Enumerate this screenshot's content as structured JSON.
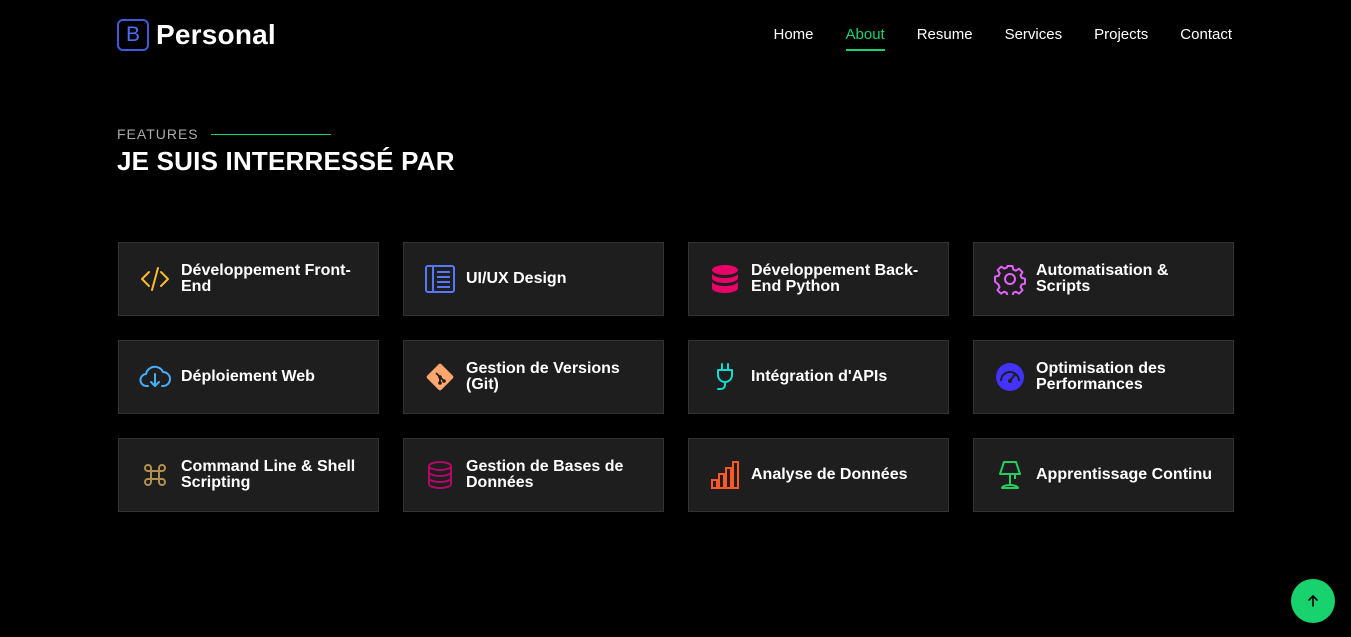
{
  "brand": {
    "letter": "B",
    "name": "Personal"
  },
  "nav": [
    {
      "label": "Home",
      "active": false
    },
    {
      "label": "About",
      "active": true
    },
    {
      "label": "Resume",
      "active": false
    },
    {
      "label": "Services",
      "active": false
    },
    {
      "label": "Projects",
      "active": false
    },
    {
      "label": "Contact",
      "active": false
    }
  ],
  "section": {
    "kicker": "FEATURES",
    "title": "JE SUIS INTERRESSÉ PAR"
  },
  "features": [
    {
      "label": "Développement Front-End",
      "icon": "code-icon",
      "color": "#ffbb2c"
    },
    {
      "label": "UI/UX Design",
      "icon": "layout-icon",
      "color": "#5578ff"
    },
    {
      "label": "Développement Back-End Python",
      "icon": "database-icon",
      "color": "#e80368"
    },
    {
      "label": "Automatisation & Scripts",
      "icon": "gear-icon",
      "color": "#e361ff"
    },
    {
      "label": "Déploiement Web",
      "icon": "cloud-download-icon",
      "color": "#47aeff"
    },
    {
      "label": "Gestion de Versions (Git)",
      "icon": "git-icon",
      "color": "#ffa76e"
    },
    {
      "label": "Intégration d'APIs",
      "icon": "plug-icon",
      "color": "#11dbcf"
    },
    {
      "label": "Optimisation des Performances",
      "icon": "speedometer-icon",
      "color": "#4233ff"
    },
    {
      "label": "Command Line & Shell Scripting",
      "icon": "command-icon",
      "color": "#b2904f"
    },
    {
      "label": "Gestion de Bases de Données",
      "icon": "database-outline-icon",
      "color": "#b20969"
    },
    {
      "label": "Analyse de Données",
      "icon": "bar-chart-icon",
      "color": "#ff5828"
    },
    {
      "label": "Apprentissage Continu",
      "icon": "lamp-icon",
      "color": "#29cc61"
    }
  ],
  "accent_color": "#18d26e"
}
